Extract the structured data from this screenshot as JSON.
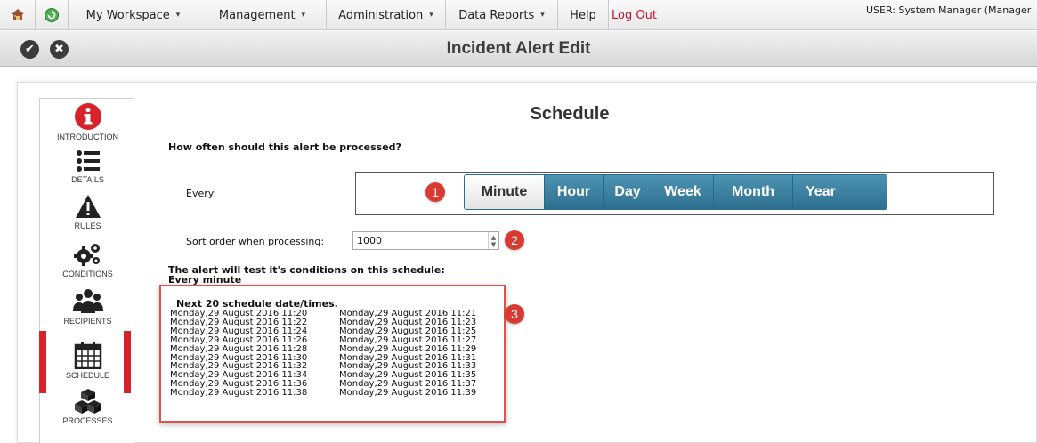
{
  "menu": {
    "items": [
      {
        "label": "My Workspace",
        "caret": "▾"
      },
      {
        "label": "Management",
        "caret": "▾"
      },
      {
        "label": "Administration",
        "caret": "▾"
      },
      {
        "label": "Data Reports",
        "caret": "▾"
      },
      {
        "label": "Help"
      },
      {
        "label": "Log Out"
      }
    ],
    "user": "USER: System Manager (Manager"
  },
  "toolbar": {
    "title": "Incident Alert Edit",
    "save_icon": "✔",
    "cancel_icon": "✖"
  },
  "nav": {
    "items": [
      {
        "label": "INTRODUCTION",
        "icon": "info-icon"
      },
      {
        "label": "DETAILS",
        "icon": "list-icon"
      },
      {
        "label": "RULES",
        "icon": "warning-icon"
      },
      {
        "label": "CONDITIONS",
        "icon": "gears-icon"
      },
      {
        "label": "RECIPIENTS",
        "icon": "users-icon"
      },
      {
        "label": "SCHEDULE",
        "icon": "calendar-icon",
        "active": true
      },
      {
        "label": "PROCESSES",
        "icon": "cubes-icon"
      }
    ]
  },
  "schedule": {
    "heading": "Schedule",
    "question": "How often should this alert be processed?",
    "every_label": "Every:",
    "units": [
      "Minute",
      "Hour",
      "Day",
      "Week",
      "Month",
      "Year"
    ],
    "selected_unit": "Minute",
    "sort_label": "Sort order when processing:",
    "sort_value": "1000",
    "test_line1": "The alert will test it's conditions on this schedule:",
    "test_line2": "Every minute",
    "times_title": "Next 20 schedule date/times.",
    "times_left": [
      "Monday,29 August 2016 11:20",
      "Monday,29 August 2016 11:22",
      "Monday,29 August 2016 11:24",
      "Monday,29 August 2016 11:26",
      "Monday,29 August 2016 11:28",
      "Monday,29 August 2016 11:30",
      "Monday,29 August 2016 11:32",
      "Monday,29 August 2016 11:34",
      "Monday,29 August 2016 11:36",
      "Monday,29 August 2016 11:38"
    ],
    "times_right": [
      "Monday,29 August 2016 11:21",
      "Monday,29 August 2016 11:23",
      "Monday,29 August 2016 11:25",
      "Monday,29 August 2016 11:27",
      "Monday,29 August 2016 11:29",
      "Monday,29 August 2016 11:31",
      "Monday,29 August 2016 11:33",
      "Monday,29 August 2016 11:35",
      "Monday,29 August 2016 11:37",
      "Monday,29 August 2016 11:39"
    ]
  },
  "markers": [
    "1",
    "2",
    "3"
  ],
  "colors": {
    "accent": "#2e6f8f",
    "marker": "#d93a31",
    "active_nav": "#d5222b",
    "logout": "#c8102e"
  }
}
